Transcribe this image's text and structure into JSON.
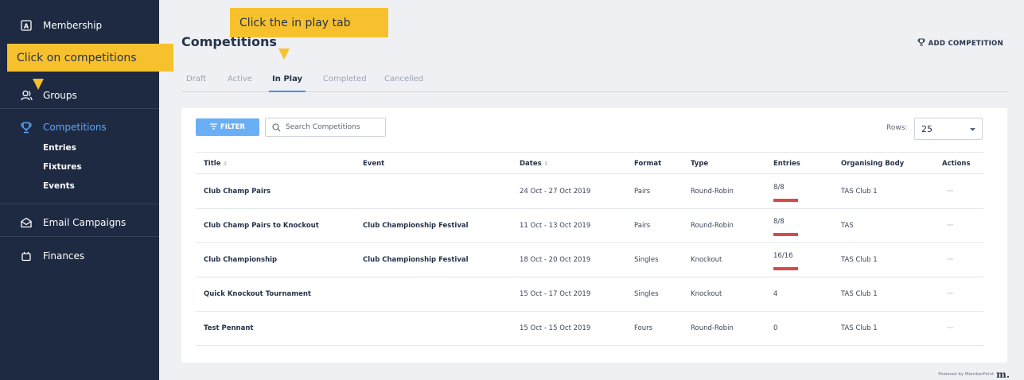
{
  "sidebar": {
    "membership": "Membership",
    "groups": "Groups",
    "competitions": "Competitions",
    "sub_items": [
      "Entries",
      "Fixtures",
      "Events"
    ],
    "email_campaigns": "Email Campaigns",
    "finances": "Finances"
  },
  "header": {
    "title": "Competitions",
    "add_button": "ADD COMPETITION"
  },
  "tabs": [
    {
      "label": "Draft",
      "active": false
    },
    {
      "label": "Active",
      "active": false
    },
    {
      "label": "In Play",
      "active": true
    },
    {
      "label": "Completed",
      "active": false
    },
    {
      "label": "Cancelled",
      "active": false
    }
  ],
  "toolbar": {
    "filter_label": "FILTER",
    "search_placeholder": "Search Competitions",
    "rows_label": "Rows:",
    "rows_value": "25"
  },
  "table": {
    "columns": [
      "Title",
      "Event",
      "Dates",
      "Format",
      "Type",
      "Entries",
      "Organising Body",
      "Actions"
    ],
    "rows": [
      {
        "title": "Club Champ Pairs",
        "event": "",
        "dates": "24 Oct - 27 Oct 2019",
        "format": "Pairs",
        "type": "Round-Robin",
        "entries": "8/8",
        "entries_full": true,
        "body": "TAS Club 1",
        "actions": "···"
      },
      {
        "title": "Club Champ Pairs to Knockout",
        "event": "Club Championship Festival",
        "dates": "11 Oct - 13 Oct 2019",
        "format": "Pairs",
        "type": "Round-Robin",
        "entries": "8/8",
        "entries_full": true,
        "body": "TAS",
        "actions": "···"
      },
      {
        "title": "Club Championship",
        "event": "Club Championship Festival",
        "dates": "18 Oct - 20 Oct 2019",
        "format": "Singles",
        "type": "Knockout",
        "entries": "16/16",
        "entries_full": true,
        "body": "TAS Club 1",
        "actions": "···"
      },
      {
        "title": "Quick Knockout Tournament",
        "event": "",
        "dates": "15 Oct - 17 Oct 2019",
        "format": "Singles",
        "type": "Knockout",
        "entries": "4",
        "entries_full": false,
        "body": "TAS Club 1",
        "actions": "···"
      },
      {
        "title": "Test Pennant",
        "event": "",
        "dates": "15 Oct - 15 Oct 2019",
        "format": "Fours",
        "type": "Round-Robin",
        "entries": "0",
        "entries_full": false,
        "body": "TAS Club 1",
        "actions": "···"
      }
    ]
  },
  "footer": {
    "powered_by": "Powered by MemberPoint",
    "logo_mark": "m."
  },
  "annotations": {
    "competitions_hint": "Click on competitions",
    "inplay_hint": "Click the in play tab"
  },
  "colors": {
    "sidebar_bg": "#1e2a42",
    "accent": "#60a6f7",
    "entries_full": "#d94a4a",
    "callout": "#f7c12e"
  }
}
